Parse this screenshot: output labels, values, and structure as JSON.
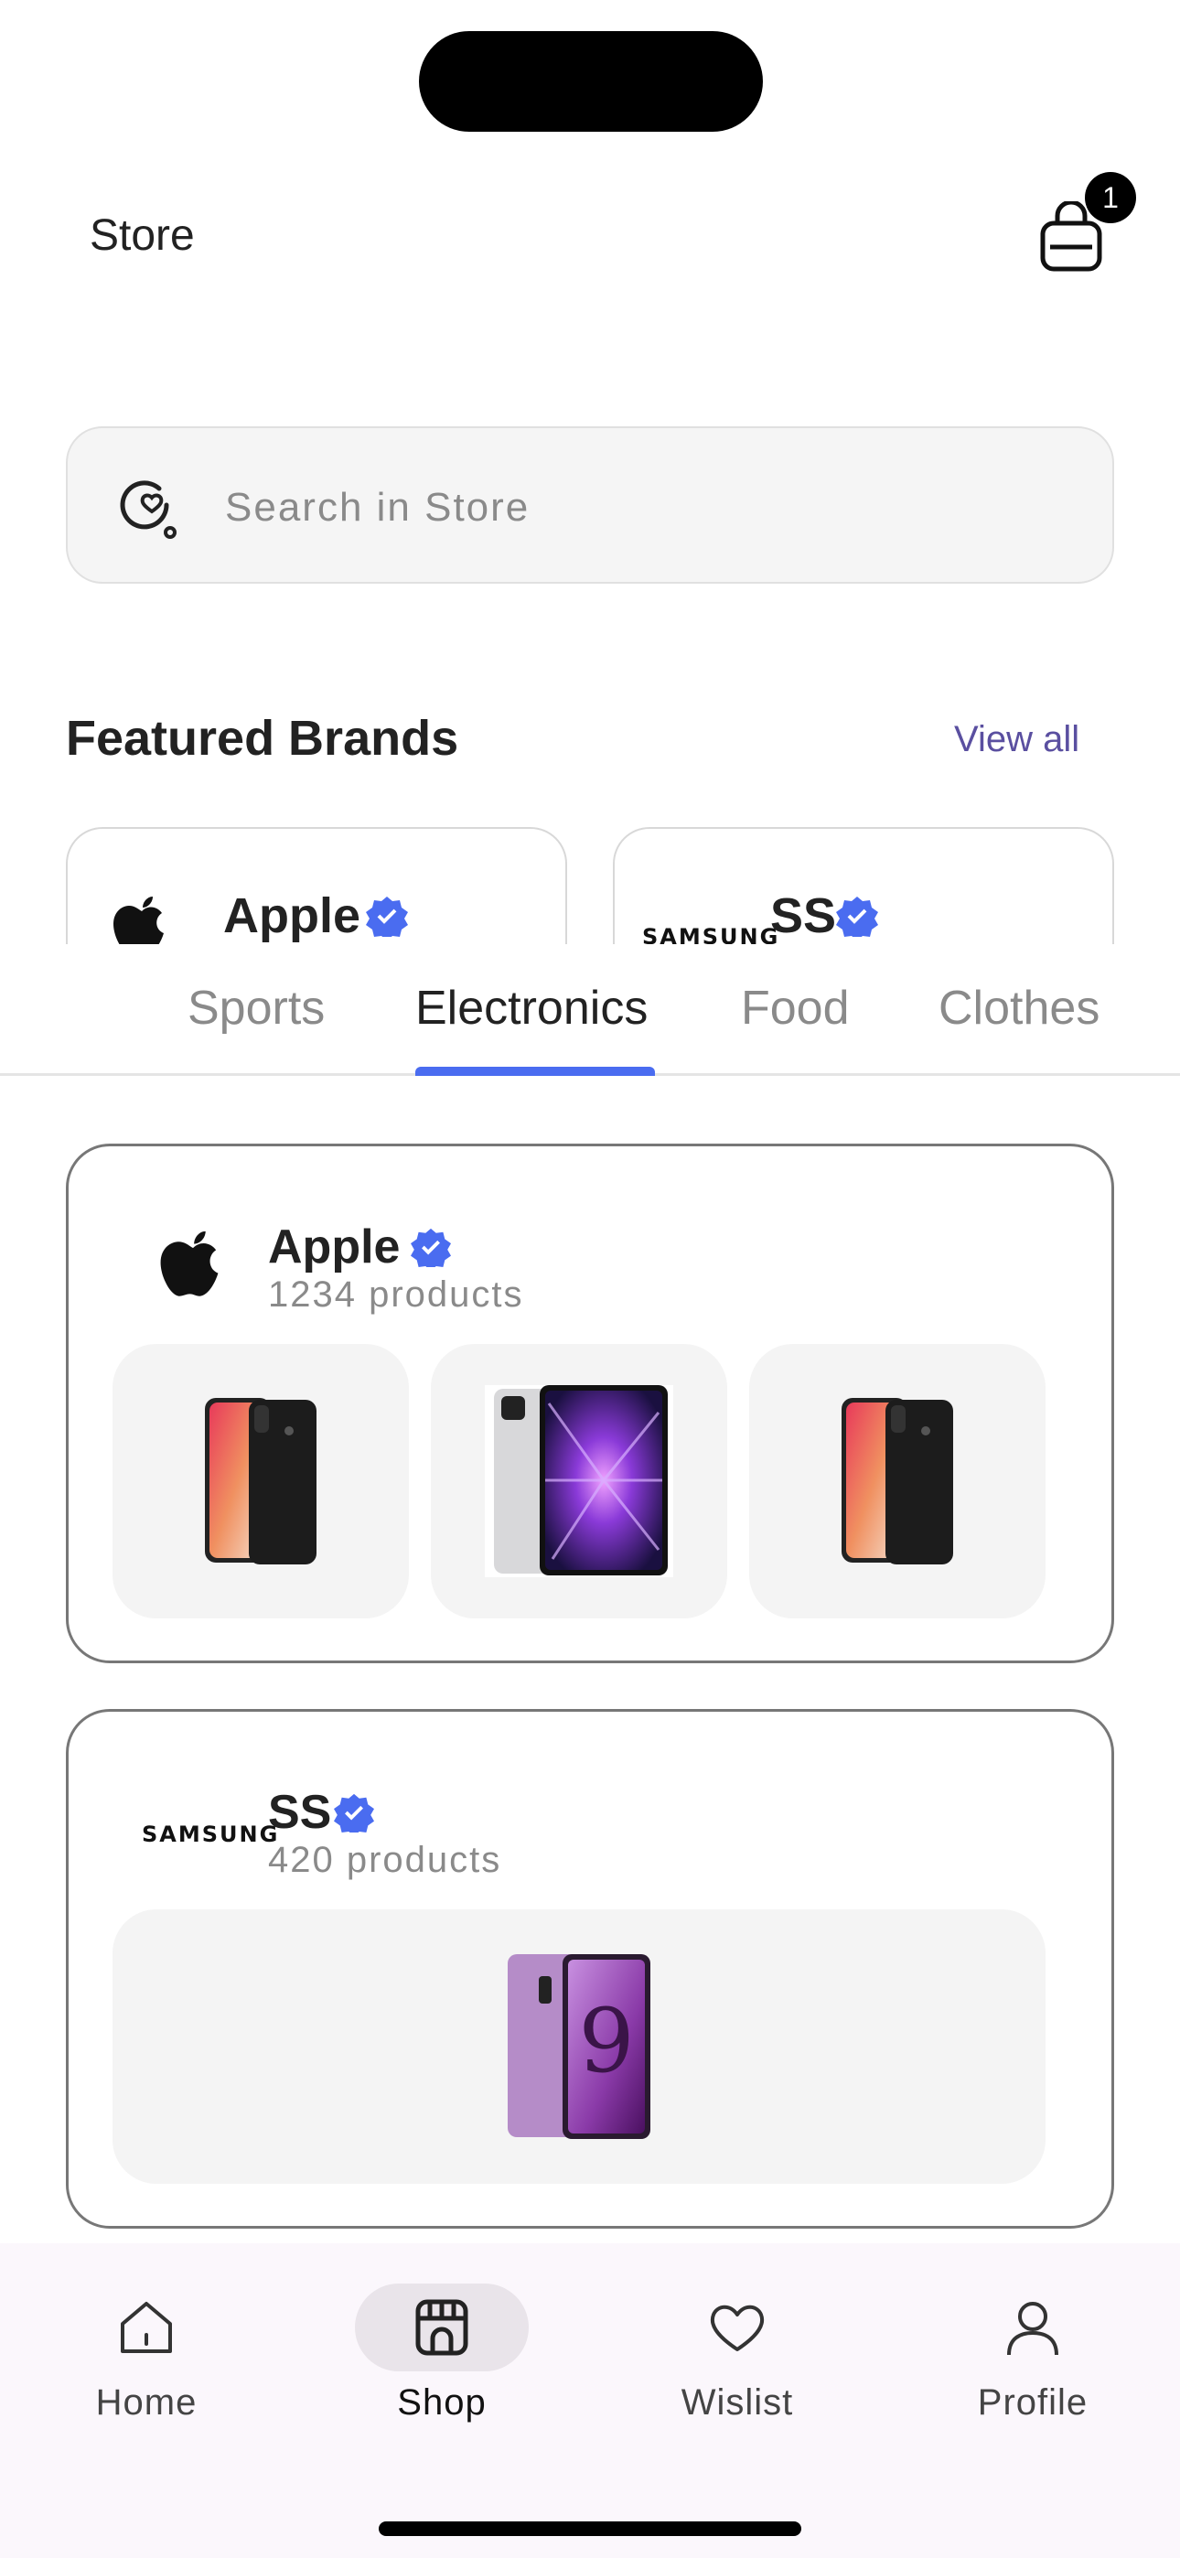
{
  "header": {
    "title": "Store",
    "cart_count": "1"
  },
  "search": {
    "placeholder": "Search in Store"
  },
  "featured": {
    "title": "Featured Brands",
    "view_all": "View all",
    "brands": [
      {
        "name": "Apple",
        "logo": "apple-logo"
      },
      {
        "name": "SS",
        "logo": "samsung-logo",
        "logo_text": "SAMSUNG"
      }
    ]
  },
  "tabs": [
    {
      "label": "Sports",
      "active": false
    },
    {
      "label": "Electronics",
      "active": true
    },
    {
      "label": "Food",
      "active": false
    },
    {
      "label": "Clothes",
      "active": false
    }
  ],
  "stores": [
    {
      "name": "Apple",
      "count": "1234 products",
      "logo": "apple-logo",
      "products": [
        "iphone-x-image",
        "ipad-pro-image",
        "iphone-x-image"
      ]
    },
    {
      "name": "SS",
      "count": "420 products",
      "logo": "samsung-logo",
      "logo_text": "SAMSUNG",
      "products": [
        "galaxy-s9-image"
      ]
    }
  ],
  "nav": [
    {
      "label": "Home",
      "icon": "home-icon"
    },
    {
      "label": "Shop",
      "icon": "shop-icon",
      "active": true
    },
    {
      "label": "Wislist",
      "icon": "heart-icon"
    },
    {
      "label": "Profile",
      "icon": "profile-icon"
    }
  ],
  "colors": {
    "accent": "#4a6cf0",
    "verified": "#4a6cf0",
    "link": "#5a4fa0",
    "nav_bg": "#fbf7fc"
  }
}
